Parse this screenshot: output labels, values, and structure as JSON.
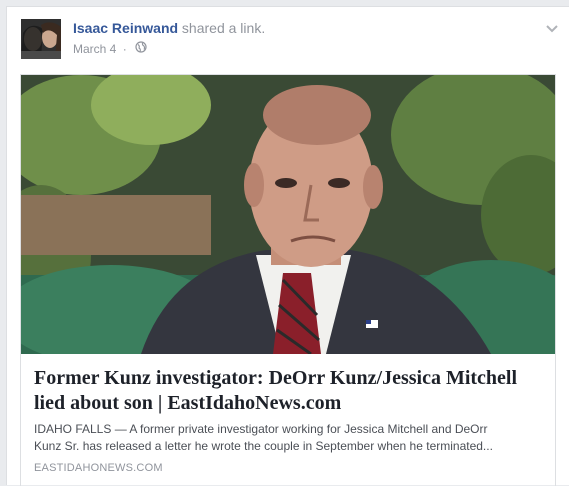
{
  "post": {
    "actor_name": "Isaac Reinwand",
    "action_text": " shared a link.",
    "date": "March 4",
    "date_separator": "·",
    "privacy_icon": "globe-icon",
    "menu_icon": "chevron-down-icon"
  },
  "link": {
    "title_line1": "Former Kunz investigator: DeOrr Kunz/Jessica Mitchell",
    "title_line2": "lied about son | EastIdahoNews.com",
    "description_line1": "IDAHO FALLS — A former private investigator working for Jessica Mitchell and DeOrr",
    "description_line2": "Kunz Sr. has released a letter he wrote the couple in September when he terminated...",
    "source": "EASTIDAHONEWS.COM"
  },
  "colors": {
    "actor": "#365899",
    "muted": "#90949c",
    "title": "#1d2129",
    "border": "#dddfe2"
  }
}
